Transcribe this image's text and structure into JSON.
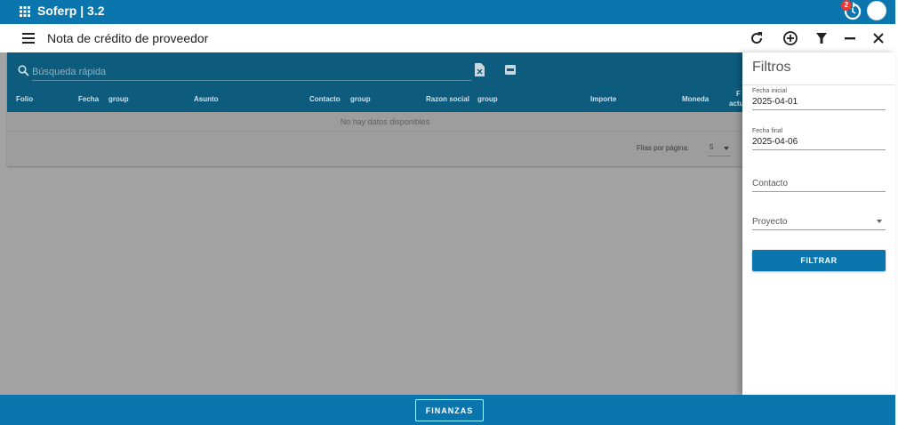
{
  "app": {
    "title": "Soferp | 3.2",
    "notification_count": "2",
    "icons": [
      "apps-grid-icon",
      "sync-icon",
      "avatar"
    ]
  },
  "toolbar": {
    "title": "Nota de crédito de proveedor",
    "icons": [
      "menu-icon",
      "refresh-icon",
      "add-circle-icon",
      "filter-icon",
      "minimize-icon",
      "close-icon"
    ]
  },
  "table": {
    "search_placeholder": "Búsqueda rápida",
    "columns": [
      "Folio",
      "Fecha",
      "group",
      "Asunto",
      "Contacto",
      "group",
      "Razon social",
      "group",
      "Importe",
      "Moneda",
      "F",
      "actu"
    ],
    "empty_text": "No hay datos disponibles",
    "rows_per_page_label": "Filas por página:",
    "rows_per_page_value": "5",
    "export_icons": [
      "excel-icon",
      "pdf-icon"
    ]
  },
  "filters": {
    "title": "Filtros",
    "fecha_inicial_label": "Fecha inicial",
    "fecha_inicial_value": "2025-04-01",
    "fecha_final_label": "Fecha final",
    "fecha_final_value": "2025-04-06",
    "contacto_label": "Contacto",
    "proyecto_label": "Proyecto",
    "button_label": "FILTRAR"
  },
  "bottom": {
    "button_label": "FINANZAS"
  },
  "colors": {
    "primary": "#0a76ad",
    "table_header": "#0d5b7d",
    "overlay": "#a3a3a3",
    "badge": "#e53935"
  }
}
